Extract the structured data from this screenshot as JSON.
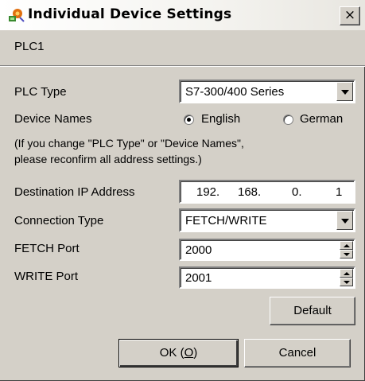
{
  "window": {
    "title": "Individual Device Settings",
    "icon": "app-settings-icon",
    "close_glyph": "×"
  },
  "tab": {
    "label": "PLC1"
  },
  "form": {
    "plc_type_label": "PLC Type",
    "plc_type_value": "S7-300/400 Series",
    "device_names_label": "Device Names",
    "device_names_options": [
      "English",
      "German"
    ],
    "device_names_selected": "English",
    "note_line1": "(If you change \"PLC Type\" or \"Device Names\",",
    "note_line2": "please reconfirm all address settings.)",
    "ip_label": "Destination IP Address",
    "ip_octets": [
      "192.",
      "168.",
      "0.",
      "1"
    ],
    "connection_type_label": "Connection Type",
    "connection_type_value": "FETCH/WRITE",
    "fetch_port_label": "FETCH Port",
    "fetch_port_value": "2000",
    "write_port_label": "WRITE Port",
    "write_port_value": "2001"
  },
  "buttons": {
    "default_label": "Default",
    "ok_label_prefix": "OK (",
    "ok_mnemonic": "O",
    "ok_label_suffix": ")",
    "cancel_label": "Cancel"
  }
}
